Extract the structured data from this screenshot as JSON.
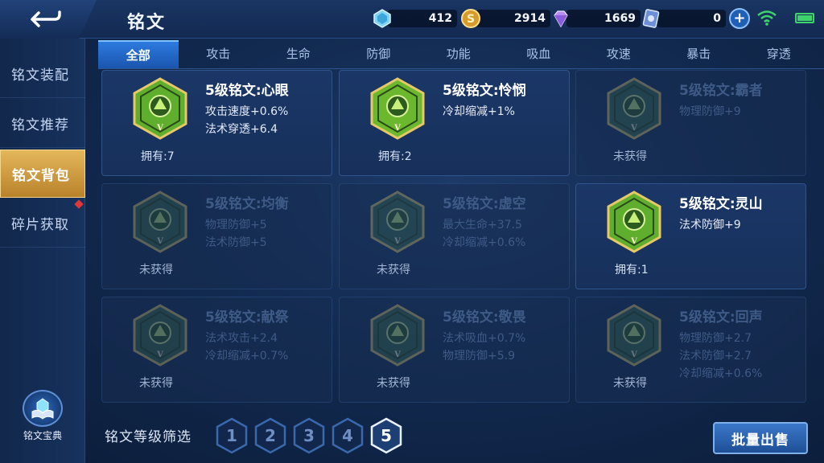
{
  "header": {
    "title": "铭文",
    "currencies": [
      {
        "icon": "diamond-crystal-icon",
        "value": "412"
      },
      {
        "icon": "gold-coin-icon",
        "value": "2914"
      },
      {
        "icon": "purple-gem-icon",
        "value": "1669"
      },
      {
        "icon": "card-ticket-icon",
        "value": "0"
      }
    ]
  },
  "sidebar": {
    "items": [
      {
        "label": "铭文装配"
      },
      {
        "label": "铭文推荐"
      },
      {
        "label": "铭文背包"
      },
      {
        "label": "碎片获取"
      }
    ],
    "codex_label": "铭文宝典"
  },
  "tabs": [
    "全部",
    "攻击",
    "生命",
    "防御",
    "功能",
    "吸血",
    "攻速",
    "暴击",
    "穿透"
  ],
  "cards": [
    {
      "name": "5级铭文:心眼",
      "stats": [
        "攻击速度+0.6%",
        "法术穿透+6.4"
      ],
      "owned": "拥有:7",
      "locked": false,
      "color": "#5fae2e"
    },
    {
      "name": "5级铭文:怜悯",
      "stats": [
        "冷却缩减+1%"
      ],
      "owned": "拥有:2",
      "locked": false,
      "color": "#6bb82f"
    },
    {
      "name": "5级铭文:霸者",
      "stats": [
        "物理防御+9"
      ],
      "owned": "未获得",
      "locked": true,
      "color": "#3a6a4a"
    },
    {
      "name": "5级铭文:均衡",
      "stats": [
        "物理防御+5",
        "法术防御+5"
      ],
      "owned": "未获得",
      "locked": true,
      "color": "#3a6a4a"
    },
    {
      "name": "5级铭文:虚空",
      "stats": [
        "最大生命+37.5",
        "冷却缩减+0.6%"
      ],
      "owned": "未获得",
      "locked": true,
      "color": "#3a6a4a"
    },
    {
      "name": "5级铭文:灵山",
      "stats": [
        "法术防御+9"
      ],
      "owned": "拥有:1",
      "locked": false,
      "color": "#5fae2e"
    },
    {
      "name": "5级铭文:献祭",
      "stats": [
        "法术攻击+2.4",
        "冷却缩减+0.7%"
      ],
      "owned": "未获得",
      "locked": true,
      "color": "#3a6a4a"
    },
    {
      "name": "5级铭文:敬畏",
      "stats": [
        "法术吸血+0.7%",
        "物理防御+5.9"
      ],
      "owned": "未获得",
      "locked": true,
      "color": "#3a6a4a"
    },
    {
      "name": "5级铭文:回声",
      "stats": [
        "物理防御+2.7",
        "法术防御+2.7",
        "冷却缩减+0.6%"
      ],
      "owned": "未获得",
      "locked": true,
      "color": "#3a6a4a"
    }
  ],
  "filter": {
    "label": "铭文等级筛选",
    "levels": [
      "1",
      "2",
      "3",
      "4",
      "5"
    ],
    "selected": "5"
  },
  "sell_button": "批量出售",
  "emblem_tier": "V"
}
